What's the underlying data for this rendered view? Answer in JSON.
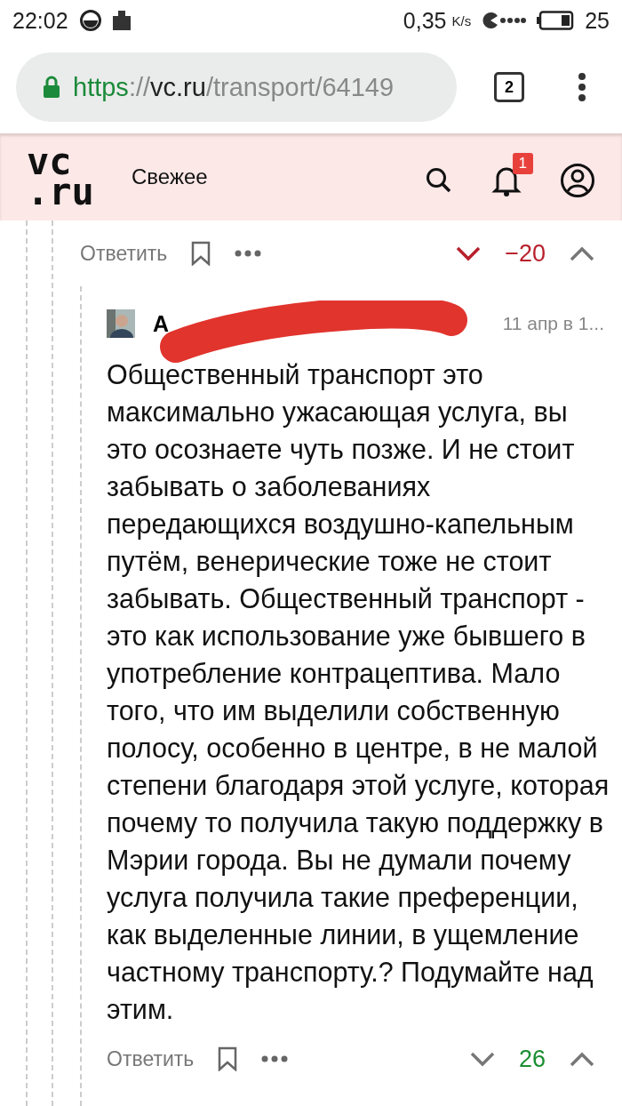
{
  "status_bar": {
    "time": "22:02",
    "speed": "0,35",
    "speed_unit": "K/s",
    "battery": "25"
  },
  "browser": {
    "url_scheme": "https",
    "url_sep": "://",
    "url_host": "vc.ru",
    "url_path": "/transport/64149",
    "tab_count": "2"
  },
  "header": {
    "logo_top": "vc",
    "logo_bottom": ".ru",
    "nav": "Свежее",
    "notification_count": "1"
  },
  "parent_actions": {
    "reply": "Ответить",
    "score": "−20",
    "downvoted": true,
    "kind": "negative"
  },
  "comment": {
    "author": "А",
    "time": "11 апр в 1...",
    "author_redacted": true,
    "text": "Общественный транспорт это максимально ужасающая услуга, вы это осознаете чуть позже. И не стоит забывать о заболеваниях передающихся воздушно-капельным путём, венерические тоже не стоит забывать. Общественный транспорт - это как использование уже бывшего в употребление контрацептива. Мало того, что им выделили собственную полосу, особенно в центре, в не малой степени благодаря этой услуге, которая почему то получила такую поддержку в Мэрии города. Вы не думали почему услуга получила такие преференции, как выделенные линии, в ущемление частному транспорту.? Подумайте над этим.",
    "actions": {
      "reply": "Ответить",
      "score": "26",
      "downvoted": false,
      "kind": "positive"
    }
  }
}
